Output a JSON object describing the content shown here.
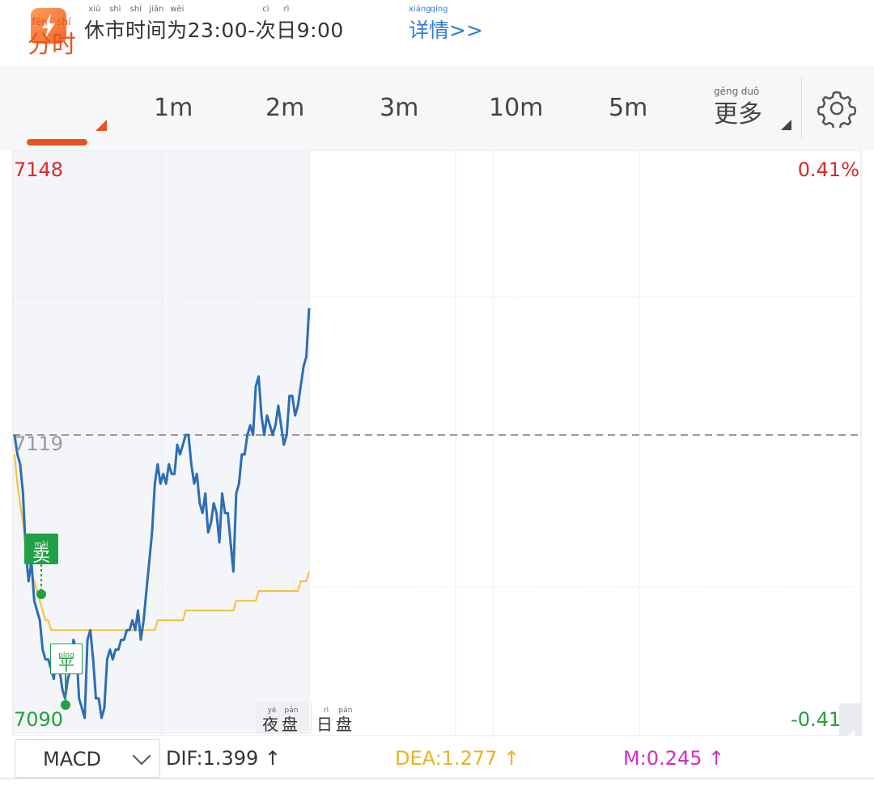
{
  "notice": {
    "text_prefix_chars": [
      {
        "char": "休",
        "py": "xiū"
      },
      {
        "char": "市",
        "py": "shì"
      },
      {
        "char": "时",
        "py": "shí"
      },
      {
        "char": "间",
        "py": "jiān"
      },
      {
        "char": "为",
        "py": "wèi"
      }
    ],
    "time_start": "23:00-",
    "next_char": {
      "char": "次",
      "py": "cì"
    },
    "day_char": {
      "char": "日",
      "py": "rì"
    },
    "time_end": "9:00",
    "detail_chars": [
      {
        "char": "详",
        "py": "xiáng"
      },
      {
        "char": "情",
        "py": "qíng"
      }
    ],
    "detail_suffix": ">>"
  },
  "tabs": {
    "active": {
      "chars": [
        {
          "char": "分",
          "py": "fēn"
        },
        {
          "char": "时",
          "py": "shí"
        }
      ]
    },
    "items": [
      "1m",
      "2m",
      "3m",
      "10m",
      "5m"
    ],
    "more": {
      "chars": [
        {
          "char": "更",
          "py": "gēng"
        },
        {
          "char": "多",
          "py": "duō"
        }
      ]
    }
  },
  "chart": {
    "price_top": "7148",
    "price_mid": "7119",
    "price_bottom": "7090",
    "pct_top": "0.41%",
    "pct_bottom": "-0.41%",
    "session_night": {
      "chars": [
        {
          "char": "夜",
          "py": "yè"
        },
        {
          "char": "盘",
          "py": "pán"
        }
      ]
    },
    "session_day": {
      "chars": [
        {
          "char": "日",
          "py": "rì"
        },
        {
          "char": "盘",
          "py": "pán"
        }
      ]
    },
    "marker_sell": {
      "char": "卖",
      "py": "mài"
    },
    "marker_flat": {
      "char": "平",
      "py": "píng"
    },
    "colors": {
      "price_line": "#2e6db4",
      "avg_line": "#f2c230",
      "up": "#d92a2a",
      "down": "#23a03a"
    }
  },
  "chart_data": {
    "type": "line",
    "ylim": [
      7090,
      7148
    ],
    "reference": 7119,
    "series": [
      {
        "values": [
          7119,
          7117,
          7116,
          7113,
          7107,
          7104,
          7106,
          7102,
          7101,
          7100,
          7097,
          7096,
          7096,
          7095,
          7094,
          7097,
          7095,
          7093,
          7092,
          7094,
          7095,
          7098,
          7097,
          7092,
          7091,
          7090,
          7098,
          7099,
          7096,
          7092,
          7092,
          7090,
          7091,
          7096,
          7097,
          7096,
          7097,
          7097,
          7098,
          7098,
          7099,
          7099,
          7100,
          7099,
          7101,
          7098,
          7100,
          7103,
          7106,
          7109,
          7114,
          7116,
          7114,
          7115,
          7114,
          7116,
          7115,
          7115,
          7118,
          7117,
          7118,
          7119,
          7119,
          7116,
          7114,
          7115,
          7112,
          7111,
          7113,
          7109,
          7110,
          7112,
          7111,
          7108,
          7113,
          7111,
          7111,
          7108,
          7105,
          7113,
          7114,
          7117,
          7117,
          7119,
          7120,
          7119,
          7124,
          7125,
          7121,
          7119,
          7121,
          7120,
          7119,
          7120,
          7122,
          7120,
          7118,
          7119,
          7123,
          7123,
          7121,
          7122,
          7124,
          7126,
          7127,
          7132
        ],
        "color": "#2e6db4"
      },
      {
        "values": [
          7117,
          7114,
          7112,
          7110,
          7108,
          7106,
          7105,
          7104,
          7103,
          7102,
          7101,
          7100,
          7100,
          7099,
          7099,
          7099,
          7099,
          7099,
          7099,
          7099,
          7099,
          7099,
          7099,
          7099,
          7099,
          7099,
          7099,
          7099,
          7099,
          7099,
          7099,
          7099,
          7099,
          7099,
          7099,
          7099,
          7099,
          7099,
          7099,
          7099,
          7099,
          7099,
          7099,
          7099,
          7099,
          7099,
          7099,
          7099,
          7099,
          7099,
          7099,
          7100,
          7100,
          7100,
          7100,
          7100,
          7100,
          7100,
          7100,
          7100,
          7100,
          7101,
          7101,
          7101,
          7101,
          7101,
          7101,
          7101,
          7101,
          7101,
          7101,
          7101,
          7101,
          7101,
          7101,
          7101,
          7101,
          7101,
          7101,
          7102,
          7102,
          7102,
          7102,
          7102,
          7102,
          7102,
          7102,
          7103,
          7103,
          7103,
          7103,
          7103,
          7103,
          7103,
          7103,
          7103,
          7103,
          7103,
          7103,
          7103,
          7103,
          7103,
          7104,
          7104,
          7104,
          7105
        ],
        "color": "#f2c230"
      }
    ]
  },
  "indicator": {
    "selected": "MACD",
    "dif": "DIF:1.399 ↑",
    "dea": "DEA:1.277 ↑",
    "m": "M:0.245 ↑",
    "colors": {
      "dif": "#333333",
      "dea": "#e7b420",
      "m": "#d12ec8"
    }
  }
}
